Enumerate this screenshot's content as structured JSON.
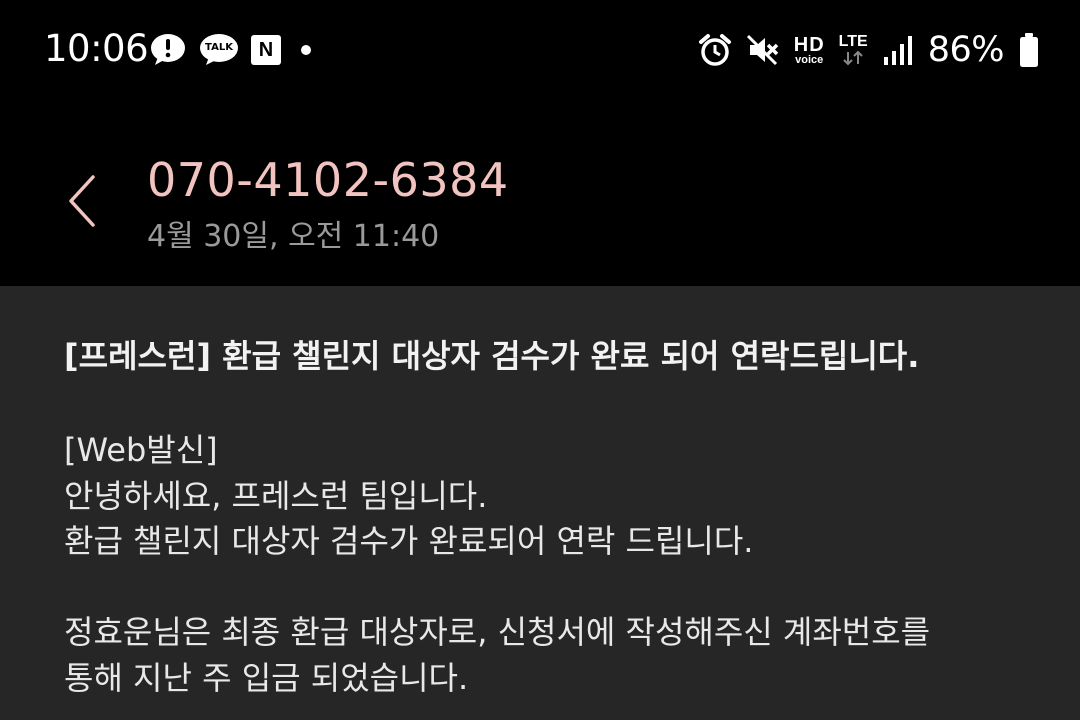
{
  "status_bar": {
    "time": "10:06",
    "notification_icons": [
      "alert-bubble-icon",
      "kakaotalk-icon",
      "naver-icon",
      "more-dot-icon"
    ],
    "kakao_label": "TALK",
    "naver_label": "N",
    "system_icons": [
      "alarm-icon",
      "mute-icon",
      "hd-voice-icon",
      "lte-icon",
      "signal-icon",
      "battery-icon"
    ],
    "hd_label": "HD",
    "voice_label": "voice",
    "lte_label": "LTE",
    "battery_percent": "86%"
  },
  "header": {
    "sender": "070-4102-6384",
    "date": "4월 30일, 오전 11:40",
    "accent_color": "#f2c4c0"
  },
  "message": {
    "subject": "[프레스런] 환급 챌린지 대상자 검수가 완료 되어 연락드립니다.",
    "paragraphs": [
      [
        "[Web발신]",
        "안녕하세요, 프레스런 팀입니다.",
        "환급 챌린지 대상자 검수가 완료되어 연락 드립니다."
      ],
      [
        "정효운님은 최종 환급 대상자로, 신청서에 작성해주신 계좌번호를",
        "통해 지난 주 입금 되었습니다."
      ]
    ]
  }
}
